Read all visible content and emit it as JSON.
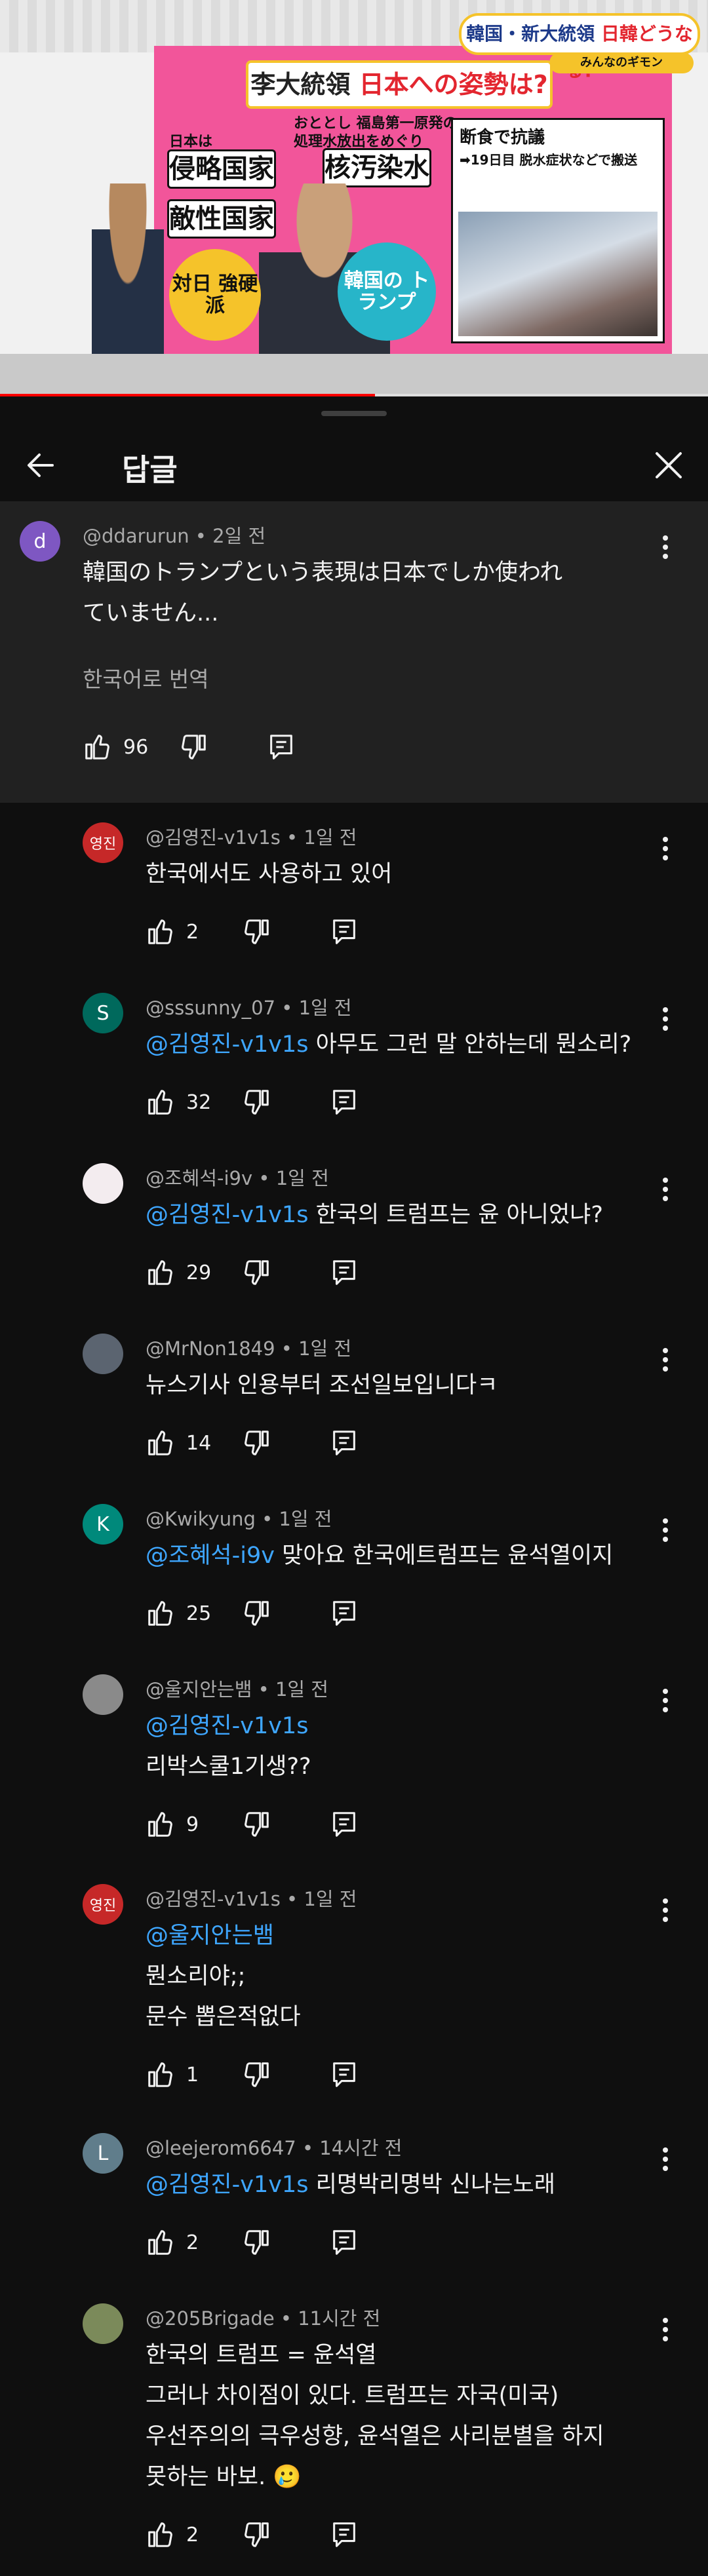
{
  "video": {
    "top_badge_prefix": "韓国・新大統領 ",
    "top_badge_accent": "日韓どうなる?",
    "sub_badge": "みんなのギモン",
    "headline_prefix": "李大統領 ",
    "headline_accent": "日本への姿勢は?",
    "label_japan": "日本は",
    "tag_invader": "侵略国家",
    "tag_enemy": "敵性国家",
    "note_line1": "おととし 福島第一原発の",
    "note_line2": "処理水放出をめぐり",
    "tag_nuclear": "核汚染水",
    "circle_hardline": "対日 強硬派",
    "circle_trump": "韓国の トランプ",
    "photo_title": "断食で抗議",
    "photo_sub": "➡19日目 脱水症状などで搬送",
    "progress": 0.53
  },
  "sheet": {
    "title": "답글"
  },
  "parent": {
    "avatar_letter": "d",
    "avatar_color": "#7e57c2",
    "meta": "@ddarurun • 2일 전",
    "text_line1": "韓国のトランプという表現は日本でしか使われ",
    "text_line2": "ていません...",
    "translate": "한국어로 번역",
    "likes": "96"
  },
  "replies": [
    {
      "avatar": "영진",
      "avatar_color": "#c62828",
      "meta": "@김영진-v1v1s • 1일 전",
      "mention": "",
      "lines": [
        "한국에서도 사용하고 있어"
      ],
      "likes": "2"
    },
    {
      "avatar": "S",
      "avatar_color": "#00695c",
      "meta": "@sssunny_07 • 1일 전",
      "mention": "@김영진-v1v1s",
      "inline": " 아무도 그런 말 안하는데 뭔소리?",
      "lines": [],
      "likes": "32"
    },
    {
      "avatar": "",
      "avatar_color": "#f3ecef",
      "meta": "@조혜석-i9v • 1일 전",
      "mention": "@김영진-v1v1s",
      "inline": "  한국의 트럼프는 윤 아니었냐?",
      "lines": [],
      "likes": "29"
    },
    {
      "avatar": "",
      "avatar_color": "#5b6470",
      "meta": "@MrNon1849 • 1일 전",
      "mention": "",
      "lines": [
        "뉴스기사 인용부터 조선일보입니다ㅋ"
      ],
      "likes": "14"
    },
    {
      "avatar": "K",
      "avatar_color": "#00897b",
      "meta": "@Kwikyung • 1일 전",
      "mention": "@조혜석-i9v",
      "inline": " 맞아요 한국에트럼프는 윤석열이지",
      "lines": [],
      "likes": "25"
    },
    {
      "avatar": "",
      "avatar_color": "#8a8a8a",
      "meta": "@울지안는뱀 • 1일 전",
      "mention": "@김영진-v1v1s",
      "inline": "",
      "lines": [
        "리박스쿨1기생??"
      ],
      "likes": "9"
    },
    {
      "avatar": "영진",
      "avatar_color": "#c62828",
      "meta": "@김영진-v1v1s • 1일 전",
      "mention": "@울지안는뱀",
      "inline": "",
      "lines": [
        "뭔소리야;;",
        "문수 뽑은적없다"
      ],
      "likes": "1"
    },
    {
      "avatar": "L",
      "avatar_color": "#607d8b",
      "meta": "@leejerom6647 • 14시간 전",
      "mention": "@김영진-v1v1s",
      "inline": "  리명박리명박 신나는노래",
      "lines": [],
      "likes": "2"
    },
    {
      "avatar": "",
      "avatar_color": "#7b8a5a",
      "meta": "@205Brigade • 11시간 전",
      "mention": "",
      "inline": "",
      "lines": [
        "한국의 트럼프 = 윤석열",
        "그러나 차이점이 있다.  트럼프는 자국(미국)",
        "우선주의의 극우성향, 윤석열은 사리분별을 하지",
        "못하는 바보. 🥲"
      ],
      "likes": "2"
    }
  ]
}
